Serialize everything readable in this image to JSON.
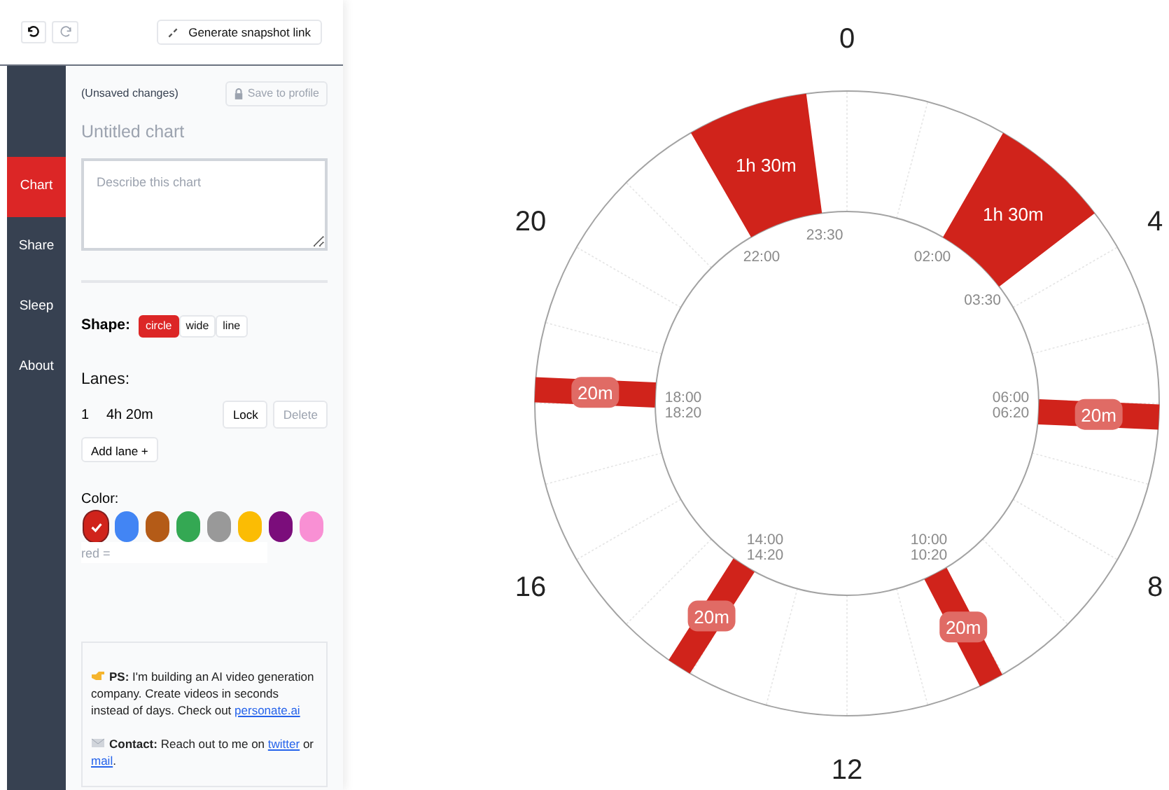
{
  "toolbar": {
    "undo": {
      "disabled": false
    },
    "redo": {
      "disabled": true
    },
    "snapshot_button": "Generate snapshot link"
  },
  "nav": [
    {
      "label": "Chart",
      "selected": true
    },
    {
      "label": "Share",
      "selected": false
    },
    {
      "label": "Sleep",
      "selected": false
    },
    {
      "label": "About",
      "selected": false
    }
  ],
  "status": "(Unsaved changes)",
  "save_button": {
    "label": "Save to profile",
    "disabled": true
  },
  "title_field": {
    "placeholder": "Untitled chart"
  },
  "description_field": {
    "placeholder": "Describe this chart"
  },
  "shape": {
    "label": "Shape:",
    "options": [
      {
        "label": "circle",
        "selected": true
      },
      {
        "label": "wide",
        "selected": false
      },
      {
        "label": "line",
        "selected": false
      }
    ]
  },
  "lanes": {
    "heading": "Lanes:",
    "rows": [
      {
        "number": "1",
        "total": "4h 20m",
        "lock": "Lock",
        "delete": {
          "label": "Delete",
          "disabled": true
        }
      }
    ],
    "add_button": "Add lane +"
  },
  "color": {
    "label": "Color:",
    "swatches": [
      {
        "color": "#d0231b",
        "selected": true
      },
      {
        "color": "#4285f4",
        "selected": false
      },
      {
        "color": "#b45b17",
        "selected": false
      },
      {
        "color": "#34a853",
        "selected": false
      },
      {
        "color": "#999999",
        "selected": false
      },
      {
        "color": "#fbbc04",
        "selected": false
      },
      {
        "color": "#7b0d7b",
        "selected": false
      },
      {
        "color": "#f990d4",
        "selected": false
      }
    ],
    "field": {
      "placeholder": "red ="
    }
  },
  "notes": [
    {
      "parts": [
        {
          "text": "**PS:** I'm building an AI video generation company. Create videos in seconds instead of days. Check out "
        },
        {
          "link": "personate.ai"
        }
      ]
    },
    {
      "parts": [
        {
          "text": "**Contact:** Reach out to me on "
        },
        {
          "link": "twitter"
        },
        {
          "text": " or "
        },
        {
          "link": "mail"
        },
        {
          "text": "."
        }
      ]
    }
  ],
  "clock": {
    "hour_labels": [
      "0",
      "4",
      "8",
      "12",
      "16",
      "20"
    ],
    "segments": [
      {
        "start": "22:00",
        "end": "23:30",
        "duration": "1h 30m"
      },
      {
        "start": "02:00",
        "end": "03:30",
        "duration": "1h 30m"
      },
      {
        "start": "18:00",
        "end": "18:20",
        "duration": "20m"
      },
      {
        "start": "06:00",
        "end": "06:20",
        "duration": "20m"
      },
      {
        "start": "14:00",
        "end": "14:20",
        "duration": "20m"
      },
      {
        "start": "10:00",
        "end": "10:20",
        "duration": "20m"
      }
    ]
  }
}
